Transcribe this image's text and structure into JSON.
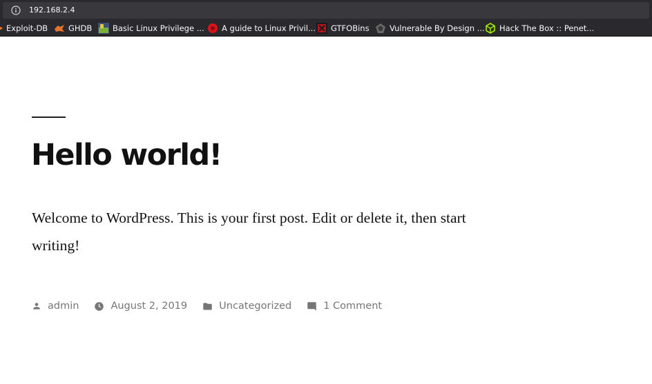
{
  "browser": {
    "url": "192.168.2.4",
    "bookmarks": [
      {
        "label": "Exploit-DB"
      },
      {
        "label": "GHDB"
      },
      {
        "label": "Basic Linux Privilege ..."
      },
      {
        "label": "A guide to Linux Privil..."
      },
      {
        "label": "GTFOBins"
      },
      {
        "label": "Vulnerable By Design ..."
      },
      {
        "label": "Hack The Box :: Penet..."
      }
    ]
  },
  "post": {
    "title": "Hello world!",
    "content": "Welcome to WordPress. This is your first post. Edit or delete it, then start writing!",
    "meta": {
      "author": "admin",
      "date": "August 2, 2019",
      "category": "Uncategorized",
      "comments": "1 Comment"
    }
  },
  "icons": [
    "info-icon",
    "exploit-db-icon",
    "ghdb-icon",
    "bookmark-favicon",
    "gtfobins-icon",
    "vulnhub-icon",
    "hackthebox-icon",
    "person-icon",
    "clock-icon",
    "folder-icon",
    "comment-icon"
  ],
  "colors": {
    "chrome": "#2a2a2e",
    "urlfield": "#38383d",
    "text": "#111111",
    "meta": "#767676"
  }
}
